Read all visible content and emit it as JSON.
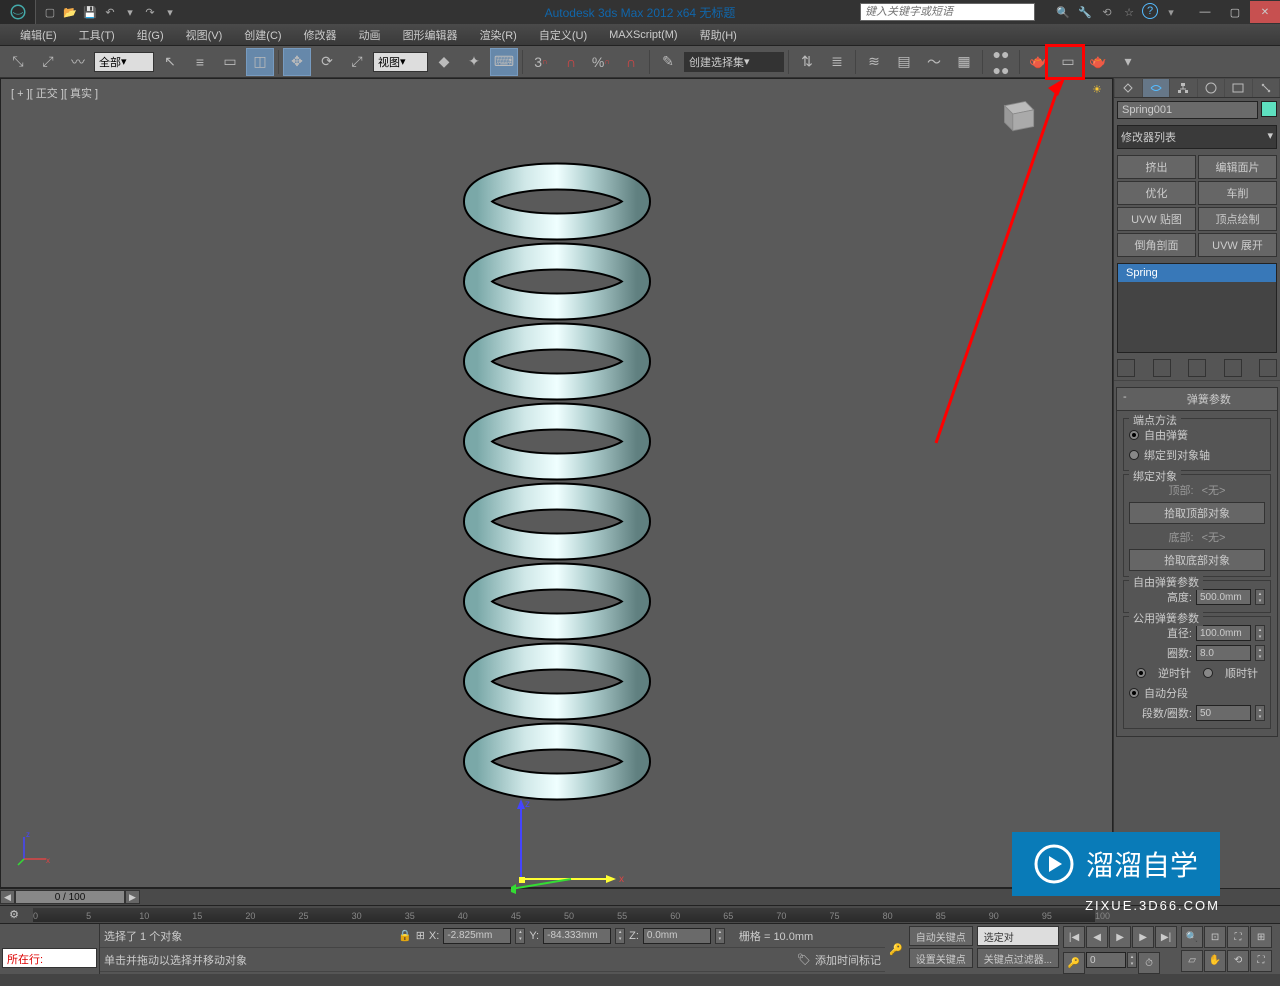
{
  "title": "Autodesk 3ds Max  2012 x64     无标题",
  "search_placeholder": "键入关键字或短语",
  "menus": [
    "编辑(E)",
    "工具(T)",
    "组(G)",
    "视图(V)",
    "创建(C)",
    "修改器",
    "动画",
    "图形编辑器",
    "渲染(R)",
    "自定义(U)",
    "MAXScript(M)",
    "帮助(H)"
  ],
  "toolbar": {
    "filter_all": "全部",
    "view_dropdown": "视图",
    "snap_number": "3",
    "named_set": "创建选择集"
  },
  "viewport": {
    "label": "[ + ][ 正交 ][ 真实 ]"
  },
  "panel": {
    "object_name": "Spring001",
    "modifier_list_label": "修改器列表",
    "mod_buttons": [
      "挤出",
      "编辑面片",
      "优化",
      "车削",
      "UVW 贴图",
      "顶点绘制",
      "倒角剖面",
      "UVW 展开"
    ],
    "stack_item": "Spring"
  },
  "rollout": {
    "title": "弹簧参数",
    "endpoint_group": "端点方法",
    "free_spring": "自由弹簧",
    "bind_axis": "绑定到对象轴",
    "bind_group": "绑定对象",
    "top_label": "顶部:",
    "none_label": "<无>",
    "pick_top": "拾取顶部对象",
    "bottom_label": "底部:",
    "pick_bottom": "拾取底部对象",
    "free_params": "自由弹簧参数",
    "height_label": "高度:",
    "height_value": "500.0mm",
    "common_params": "公用弹簧参数",
    "diameter_label": "直径:",
    "diameter_value": "100.0mm",
    "turns_label": "圈数:",
    "turns_value": "8.0",
    "ccw": "逆时针",
    "cw": "顺时针",
    "auto_seg": "自动分段",
    "seg_per_turn_label": "段数/圈数:",
    "seg_per_turn_value": "50"
  },
  "timeline": {
    "slider": "0 / 100",
    "ticks": [
      "0",
      "5",
      "10",
      "15",
      "20",
      "25",
      "30",
      "35",
      "40",
      "45",
      "50",
      "55",
      "60",
      "65",
      "70",
      "75",
      "80",
      "85",
      "90",
      "95",
      "100"
    ]
  },
  "status": {
    "selected": "选择了 1 个对象",
    "prompt": "单击并拖动以选择并移动对象",
    "x_label": "X:",
    "x_value": "-2.825mm",
    "y_label": "Y:",
    "y_value": "-84.333mm",
    "z_label": "Z:",
    "z_value": "0.0mm",
    "grid": "栅格 = 10.0mm",
    "add_time_tag": "添加时间标记",
    "auto_key": "自动关键点",
    "set_key": "设置关键点",
    "selected_set": "选定对",
    "key_filter": "关键点过滤器...",
    "frame_value": "0",
    "script_label": "所在行:"
  },
  "watermark": {
    "brand": "溜溜自学",
    "url": "ZIXUE.3D66.COM"
  }
}
